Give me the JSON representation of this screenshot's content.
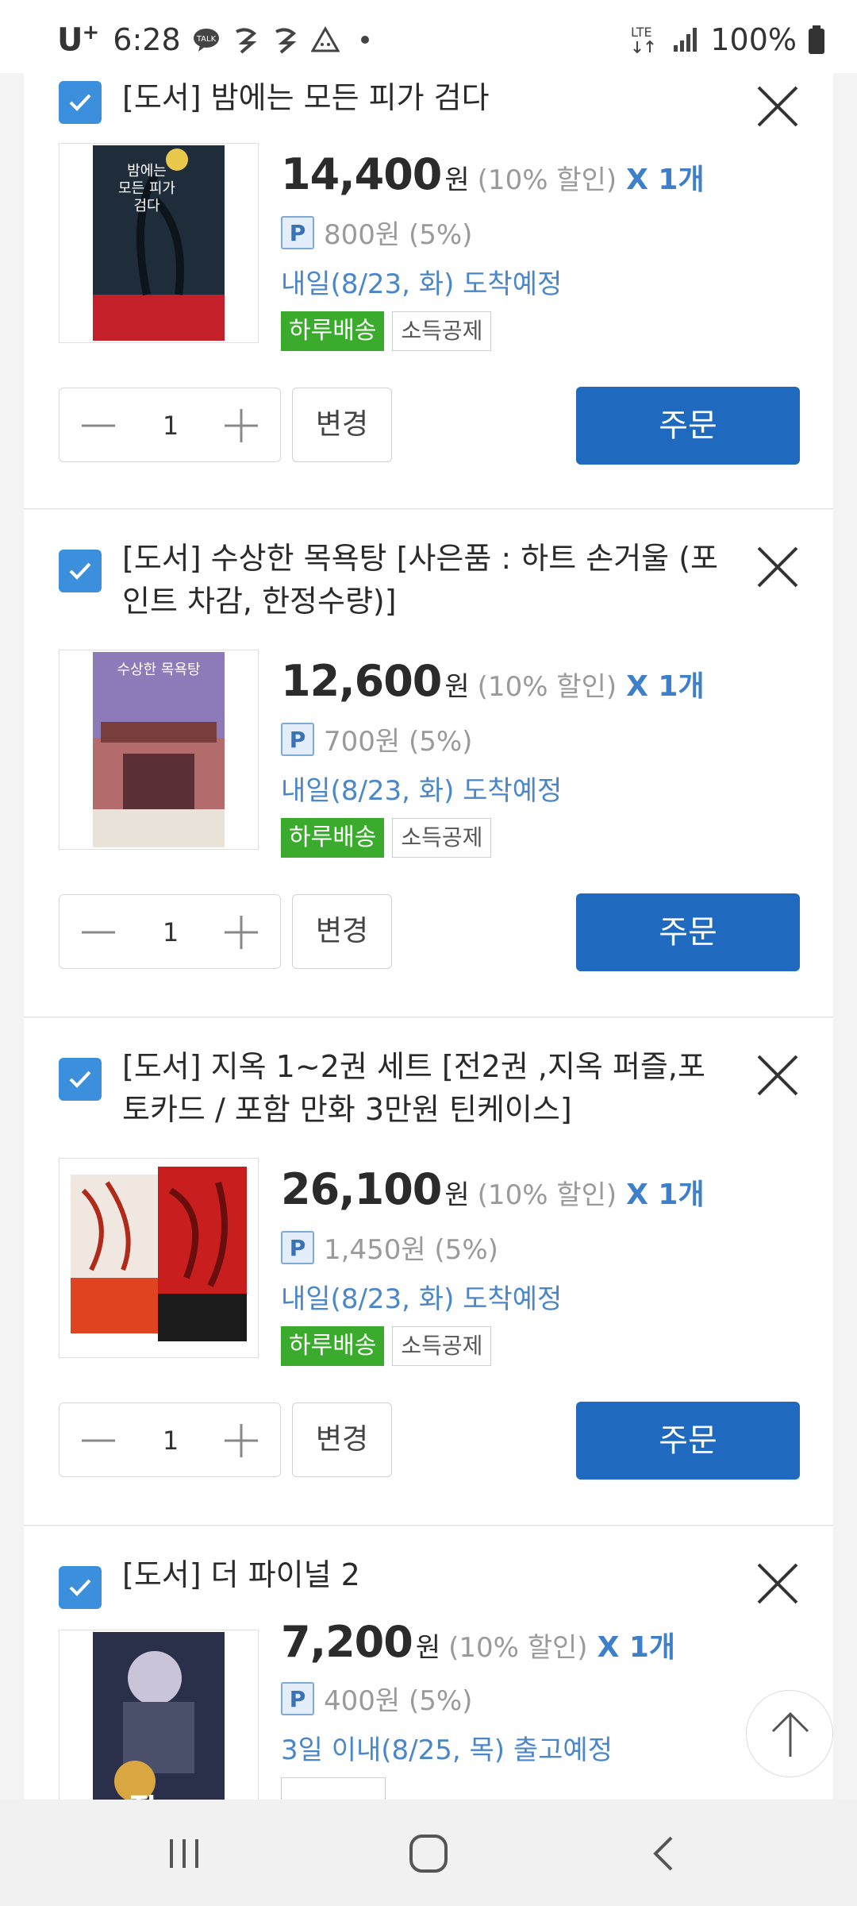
{
  "status_bar": {
    "carrier": "U",
    "carrier_sup": "+",
    "time": "6:28",
    "network": "LTE",
    "battery": "100%",
    "icons": [
      "talk-icon",
      "messenger-icon",
      "messenger-icon",
      "alert-triangle-icon",
      "dot-icon",
      "signal-icon",
      "battery-icon"
    ]
  },
  "items": [
    {
      "title": "[도서] 밤에는 모든 피가 검다",
      "price": "14,400",
      "won": "원",
      "discount": "(10% 할인)",
      "qty_label": "X 1개",
      "point_badge": "P",
      "points": "800원 (5%)",
      "delivery": "내일(8/23, 화) 도착예정",
      "tag_green": "하루배송",
      "tag_gray": "소득공제",
      "quantity": "1",
      "change_label": "변경",
      "order_label": "주문",
      "cover_color": "#1f2d3a"
    },
    {
      "title": "[도서] 수상한 목욕탕 [사은품 : 하트 손거울 (포인트 차감, 한정수량)]",
      "price": "12,600",
      "won": "원",
      "discount": "(10% 할인)",
      "qty_label": "X 1개",
      "point_badge": "P",
      "points": "700원 (5%)",
      "delivery": "내일(8/23, 화) 도착예정",
      "tag_green": "하루배송",
      "tag_gray": "소득공제",
      "quantity": "1",
      "change_label": "변경",
      "order_label": "주문",
      "cover_color": "#8d7ab8"
    },
    {
      "title": "[도서] 지옥 1~2권 세트 [전2권 ,지옥 퍼즐,포토카드 / 포함 만화 3만원 틴케이스]",
      "price": "26,100",
      "won": "원",
      "discount": "(10% 할인)",
      "qty_label": "X 1개",
      "point_badge": "P",
      "points": "1,450원 (5%)",
      "delivery": "내일(8/23, 화) 도착예정",
      "tag_green": "하루배송",
      "tag_gray": "소득공제",
      "quantity": "1",
      "change_label": "변경",
      "order_label": "주문",
      "cover_color": "#c23a26"
    },
    {
      "title": "[도서] 더 파이널 2",
      "price": "7,200",
      "won": "원",
      "discount": "(10% 할인)",
      "qty_label": "X 1개",
      "point_badge": "P",
      "points": "400원 (5%)",
      "delivery": "3일 이내(8/25, 목) 출고예정",
      "cover_color": "#2a2f4a"
    }
  ],
  "colors": {
    "accent_blue": "#1f6abf",
    "link_blue": "#4a86c8",
    "green_tag": "#3aab2c"
  }
}
